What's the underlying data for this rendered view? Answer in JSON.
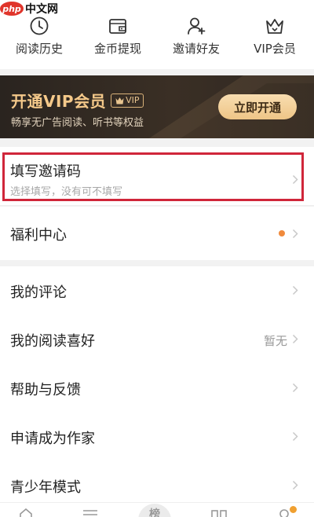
{
  "watermark": {
    "logo_text": "php",
    "text": "中文网"
  },
  "quick_actions": [
    {
      "label": "阅读历史",
      "icon": "clock-icon"
    },
    {
      "label": "金币提现",
      "icon": "wallet-icon"
    },
    {
      "label": "邀请好友",
      "icon": "add-user-icon"
    },
    {
      "label": "VIP会员",
      "icon": "crown-icon"
    }
  ],
  "vip_banner": {
    "title": "开通VIP会员",
    "badge": "VIP",
    "subtitle": "畅享无广告阅读、听书等权益",
    "button": "立即开通"
  },
  "invite_code": {
    "title": "填写邀请码",
    "subtitle": "选择填写，没有可不填写"
  },
  "welfare": {
    "label": "福利中心"
  },
  "menu": [
    {
      "label": "我的评论",
      "value": ""
    },
    {
      "label": "我的阅读喜好",
      "value": "暂无"
    },
    {
      "label": "帮助与反馈",
      "value": ""
    },
    {
      "label": "申请成为作家",
      "value": ""
    },
    {
      "label": "青少年模式",
      "value": ""
    }
  ],
  "tabbar": {
    "center_label": "榜"
  },
  "colors": {
    "accent": "#d0263a",
    "vip_gold": "#f5c98a",
    "dot": "#f08a3c"
  }
}
